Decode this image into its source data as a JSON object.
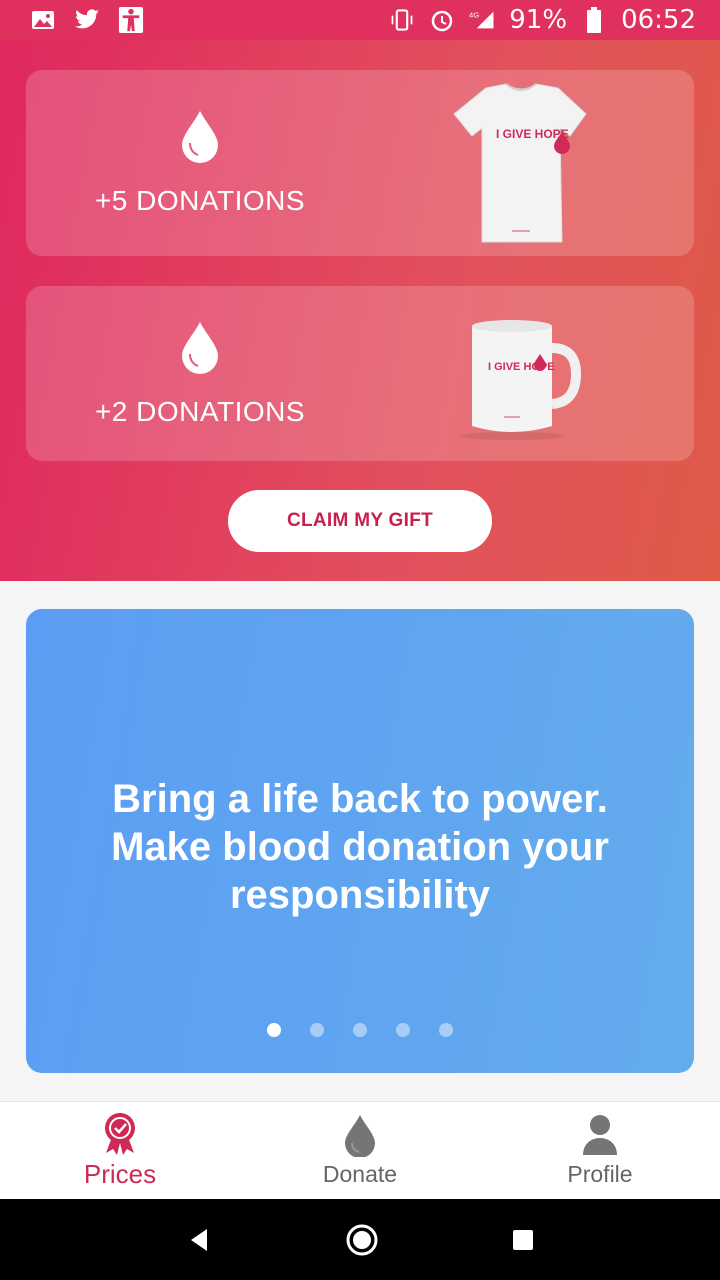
{
  "status_bar": {
    "battery": "91%",
    "time": "06:52",
    "network": "4G",
    "icons": [
      "image-icon",
      "twitter-icon",
      "accessibility-icon",
      "vibrate-icon",
      "alarm-icon",
      "signal-icon",
      "battery-icon"
    ]
  },
  "rewards": [
    {
      "label": "+5 DONATIONS",
      "item_text": "I GIVE HOPE",
      "image": "t-shirt"
    },
    {
      "label": "+2 DONATIONS",
      "item_text": "I GIVE HOPE",
      "image": "mug"
    }
  ],
  "claim_button": {
    "label": "CLAIM MY GIFT"
  },
  "banner": {
    "lines": [
      "Bring a life back to power.",
      "Make blood donation your",
      "responsibility"
    ],
    "pages": 5,
    "active_page": 1
  },
  "tabs": [
    {
      "label": "Prices",
      "icon": "award-icon",
      "active": true
    },
    {
      "label": "Donate",
      "icon": "drop-icon",
      "active": false
    },
    {
      "label": "Profile",
      "icon": "person-icon",
      "active": false
    }
  ],
  "colors": {
    "brand": "#e0305e",
    "accent_text": "#cf2a57",
    "banner": "#5b9df4"
  }
}
